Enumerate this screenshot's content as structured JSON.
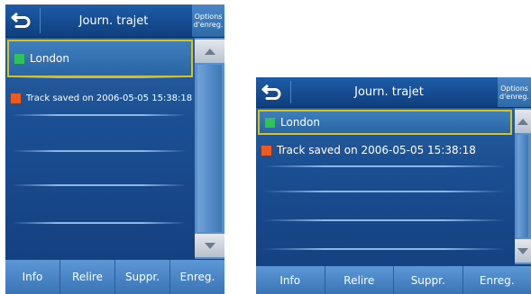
{
  "screens": [
    {
      "title": "Journ. trajet",
      "options": {
        "line1": "Options",
        "line2": "d'enreg."
      },
      "items": [
        {
          "label": "London",
          "color": "#2fc25b",
          "selected": true
        },
        {
          "label": "Track saved on 2006-05-05 15:38:18",
          "color": "#ef5a1e",
          "selected": false
        }
      ],
      "buttons": [
        "Info",
        "Relire",
        "Suppr.",
        "Enreg."
      ]
    },
    {
      "title": "Journ. trajet",
      "options": {
        "line1": "Options",
        "line2": "d'enreg."
      },
      "items": [
        {
          "label": "London",
          "color": "#2fc25b",
          "selected": true
        },
        {
          "label": "Track saved on 2006-05-05 15:38:18",
          "color": "#ef5a1e",
          "selected": false
        }
      ],
      "buttons": [
        "Info",
        "Relire",
        "Suppr.",
        "Enreg."
      ]
    }
  ],
  "icons": {
    "back": "back-arrow-icon",
    "scroll_up": "triangle-up-icon",
    "scroll_down": "triangle-down-icon"
  },
  "colors": {
    "selection_border": "#d9c21a",
    "panel_blue": "#1b4f93",
    "bar_blue": "#4a86c8"
  }
}
